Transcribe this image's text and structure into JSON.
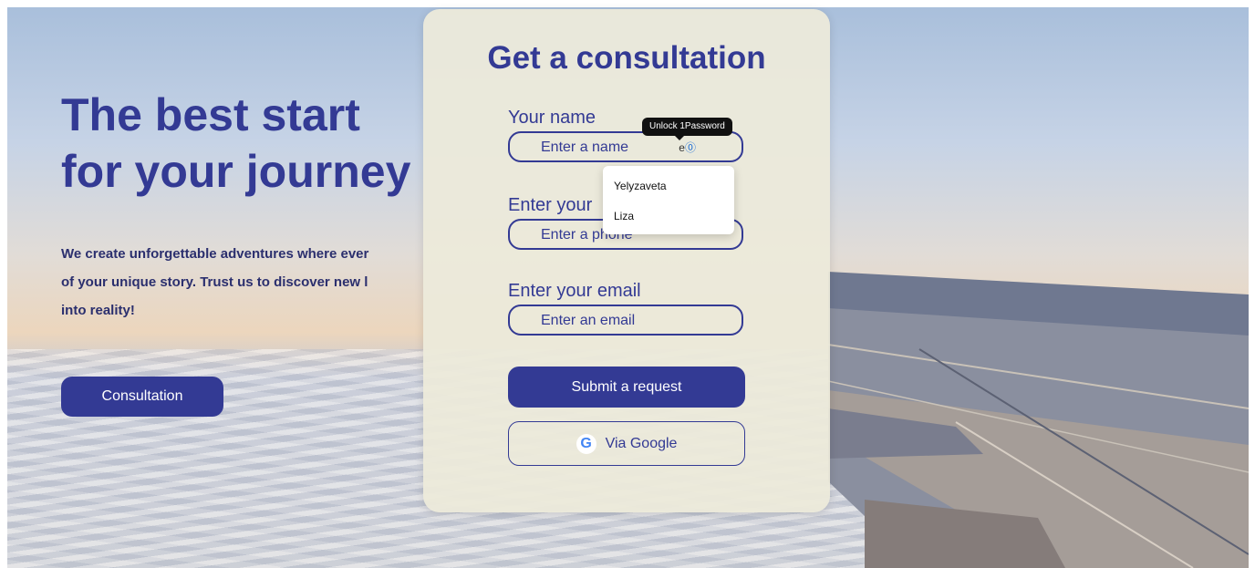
{
  "hero": {
    "title_line1": "The best start",
    "title_line2": "for your journey",
    "text_line1": "We create unforgettable adventures where ever",
    "text_line2": "of your unique story. Trust us to discover new l",
    "text_line3": "into reality!",
    "cta_label": "Consultation"
  },
  "form": {
    "title": "Get a consultation",
    "name_label": "Your name",
    "name_placeholder": "Enter a name",
    "phone_label": "Enter your",
    "phone_placeholder": "Enter a phone",
    "email_label": "Enter your email",
    "email_placeholder": "Enter an email",
    "submit_label": "Submit a request",
    "google_label": "Via Google",
    "google_icon_letter": "G"
  },
  "autofill": {
    "tooltip": "Unlock 1Password",
    "suggestions": [
      "Yelyzaveta",
      "Liza"
    ]
  },
  "colors": {
    "primary": "#333a94",
    "panel": "#eceada"
  },
  "icons": {
    "password_manager": "1password-icon",
    "google": "google-icon"
  }
}
